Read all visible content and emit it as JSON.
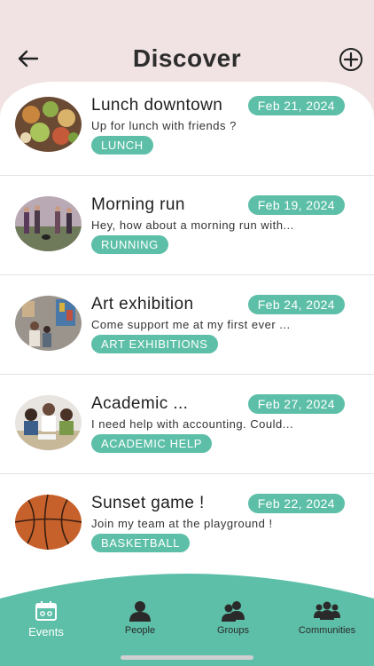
{
  "header": {
    "title": "Discover"
  },
  "events": [
    {
      "title": "Lunch downtown",
      "date": "Feb 21, 2024",
      "description": "Up for lunch with friends ?",
      "tag": "LUNCH"
    },
    {
      "title": "Morning run",
      "date": "Feb 19, 2024",
      "description": "Hey, how about a morning run with...",
      "tag": "RUNNING"
    },
    {
      "title": "Art exhibition",
      "date": "Feb 24, 2024",
      "description": "Come support me at my first ever ...",
      "tag": "ART EXHIBITIONS"
    },
    {
      "title": "Academic ...",
      "date": "Feb 27, 2024",
      "description": "I need help with accounting. Could...",
      "tag": "ACADEMIC HELP"
    },
    {
      "title": "Sunset game !",
      "date": "Feb 22, 2024",
      "description": "Join my team at the playground !",
      "tag": "BASKETBALL"
    }
  ],
  "tabs": [
    {
      "label": "Events",
      "icon": "calendar-icon"
    },
    {
      "label": "People",
      "icon": "person-icon"
    },
    {
      "label": "Groups",
      "icon": "group-icon"
    },
    {
      "label": "Communities",
      "icon": "communities-icon"
    }
  ],
  "colors": {
    "accent": "#5dbfa8",
    "header_bg": "#f1e3e3"
  }
}
